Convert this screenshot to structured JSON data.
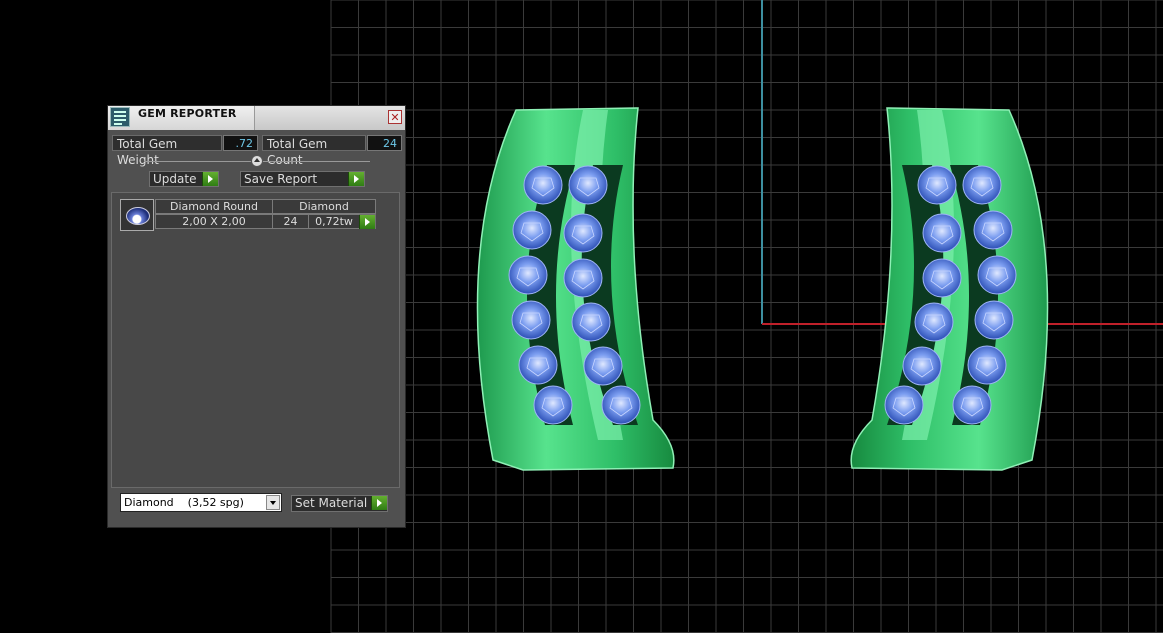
{
  "panel": {
    "title": "GEM REPORTER",
    "close": "✕",
    "total_weight_label": "Total Gem Weight",
    "total_weight_value": ".72",
    "total_count_label": "Total Gem Count",
    "total_count_value": "24",
    "update_label": "Update",
    "save_report_label": "Save Report",
    "gem_row": {
      "shape": "Diamond Round",
      "size": "2,00 X 2,00",
      "material": "Diamond",
      "count": "24",
      "weight": "0,72tw"
    },
    "material_select": "Diamond    (3,52 spg)",
    "set_material_label": "Set Material"
  },
  "colors": {
    "viewport_bg": "#000000",
    "grid": "#3a3a3a",
    "axis_y": "#3d8fa0",
    "axis_x": "#c0202a",
    "metal": "#4fe08a",
    "gem": "#4a6fd8",
    "accent_green": "#4fa424"
  },
  "icons": [
    "gem-reporter-app-icon",
    "close-icon",
    "slider-knob",
    "go-arrow-icon",
    "dropdown-arrow-icon",
    "gem-thumbnail"
  ]
}
